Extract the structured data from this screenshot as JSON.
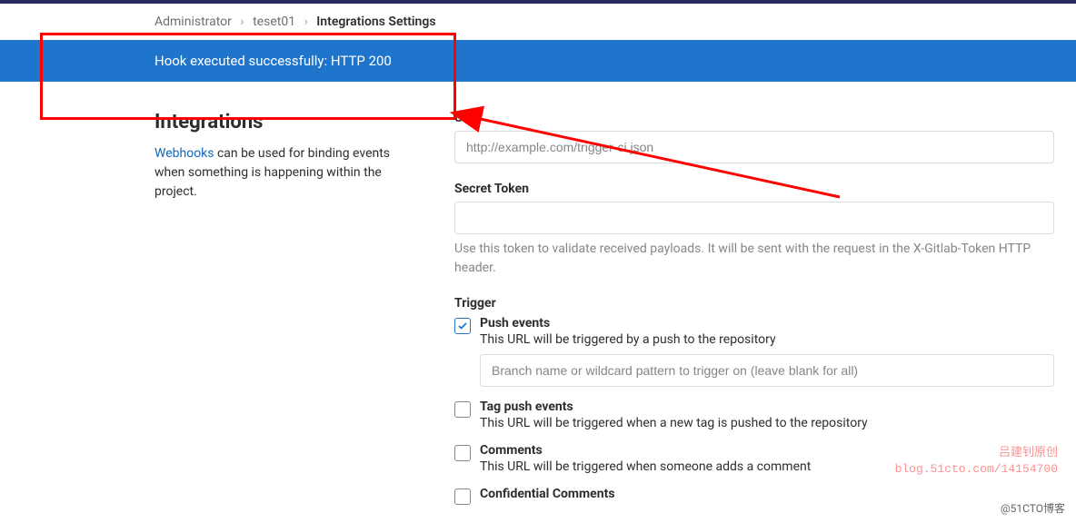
{
  "breadcrumb": {
    "admin": "Administrator",
    "project": "teset01",
    "current": "Integrations Settings"
  },
  "flash": {
    "message": "Hook executed successfully: HTTP 200"
  },
  "left": {
    "heading": "Integrations",
    "link_text": "Webhooks",
    "desc_rest": " can be used for binding events when something is happening within the project."
  },
  "url": {
    "label": "URL",
    "placeholder": "http://example.com/trigger-ci.json"
  },
  "secret": {
    "label": "Secret Token",
    "help": "Use this token to validate received payloads. It will be sent with the request in the X-Gitlab-Token HTTP header."
  },
  "trigger": {
    "label": "Trigger",
    "items": [
      {
        "title": "Push events",
        "sub": "This URL will be triggered by a push to the repository",
        "checked": true,
        "branch_ph": "Branch name or wildcard pattern to trigger on (leave blank for all)"
      },
      {
        "title": "Tag push events",
        "sub": "This URL will be triggered when a new tag is pushed to the repository",
        "checked": false
      },
      {
        "title": "Comments",
        "sub": "This URL will be triggered when someone adds a comment",
        "checked": false
      },
      {
        "title": "Confidential Comments",
        "sub": "",
        "checked": false
      }
    ]
  },
  "watermark": {
    "line1": "吕建钊原创",
    "line2": "blog.51cto.com/14154700",
    "cto": "@51CTO博客"
  }
}
